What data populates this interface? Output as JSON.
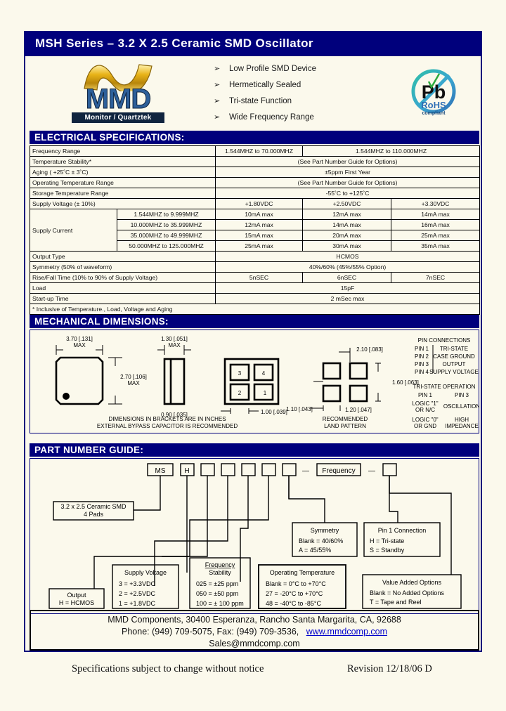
{
  "document": {
    "title": "MSH Series – 3.2 X 2.5 Ceramic SMD Oscillator"
  },
  "features": {
    "bullet_glyph": "➢",
    "items": [
      "Low Profile SMD Device",
      "Hermetically Sealed",
      "Tri-state Function",
      "Wide Frequency Range"
    ]
  },
  "logo": {
    "name": "MMD",
    "tagline": "Monitor / Quartztek"
  },
  "rohs": {
    "symbol": "Pb",
    "line1": "RoHS",
    "line2": "compliant"
  },
  "electrical": {
    "heading": "ELECTRICAL SPECIFICATIONS:",
    "rows": [
      {
        "label": "Frequency Range",
        "cells": [
          "1.544MHZ to 70.000MHZ",
          "1.544MHZ to 110.000MHZ"
        ],
        "spans": [
          1,
          2
        ]
      },
      {
        "label": "Temperature Stability*",
        "cells": [
          "(See Part Number Guide for Options)"
        ],
        "spans": [
          3
        ]
      },
      {
        "label": "Aging ( +25˚C ± 3˚C)",
        "cells": [
          "±5ppm First Year"
        ],
        "spans": [
          3
        ]
      },
      {
        "label": "Operating Temperature Range",
        "cells": [
          "(See Part Number Guide for Options)"
        ],
        "spans": [
          3
        ]
      },
      {
        "label": "Storage Temperature Range",
        "cells": [
          "-55˚C to +125˚C"
        ],
        "spans": [
          3
        ]
      },
      {
        "label": "Supply Voltage (± 10%)",
        "cells": [
          "+1.80VDC",
          "+2.50VDC",
          "+3.30VDC"
        ],
        "spans": [
          1,
          1,
          1
        ]
      }
    ],
    "supply_current": {
      "label": "Supply Current",
      "ranges": [
        "1.544MHZ to 9.999MHZ",
        "10.000MHZ to 35.999MHZ",
        "35.000MHZ to 49.999MHZ",
        "50.000MHZ to 125.000MHZ"
      ],
      "values": [
        [
          "10mA max",
          "12mA max",
          "14mA max"
        ],
        [
          "12mA max",
          "14mA max",
          "16mA max"
        ],
        [
          "15mA max",
          "20mA max",
          "25mA max"
        ],
        [
          "25mA max",
          "30mA max",
          "35mA max"
        ]
      ]
    },
    "rows_tail": [
      {
        "label": "Output Type",
        "cells": [
          "HCMOS"
        ],
        "spans": [
          3
        ]
      },
      {
        "label": "Symmetry (50% of waveform)",
        "cells": [
          "40%/60% (45%/55% Option)"
        ],
        "spans": [
          3
        ]
      },
      {
        "label": "Rise/Fall Time (10% to 90% of Supply Voltage)",
        "cells": [
          "5nSEC",
          "6nSEC",
          "7nSEC"
        ],
        "spans": [
          1,
          1,
          1
        ]
      },
      {
        "label": "Load",
        "cells": [
          "15pF"
        ],
        "spans": [
          3
        ]
      },
      {
        "label": "Start-up Time",
        "cells": [
          "2 mSec max"
        ],
        "spans": [
          3
        ]
      }
    ],
    "footnote": "*  Inclusive of Temperature., Load, Voltage and Aging"
  },
  "mechanical": {
    "heading": "MECHANICAL DIMENSIONS:",
    "dim_width": "3.70 [.131]",
    "dim_width_note": "MAX",
    "dim_height": "2.70 [.106]",
    "dim_height_note": "MAX",
    "dim_thickness": "1.30 [.051]",
    "dim_thickness_note": "MAX",
    "dim_pad_a": "0.90 [.035]",
    "dim_pad_b": "1.00 [.039]",
    "dim_land_a": "2.10 [.083]",
    "dim_land_b": "1.60 [.063]",
    "dim_land_c": "1.10 [.043]",
    "dim_land_d": "1.20 [.047]",
    "pad_numbers": [
      "3",
      "4",
      "2",
      "1"
    ],
    "note1": "DIMENSIONS IN BRACKETS ARE IN INCHES",
    "note2": "EXTERNAL BYPASS CAPACITOR IS RECOMMENDED",
    "land_caption1": "RECOMMENDED",
    "land_caption2": "LAND PATTERN",
    "pin_connections": {
      "title": "PIN CONNECTIONS",
      "rows": [
        {
          "pin": "PIN 1",
          "fn": "TRI-STATE"
        },
        {
          "pin": "PIN 2",
          "fn": "CASE GROUND"
        },
        {
          "pin": "PIN 3",
          "fn": "OUTPUT"
        },
        {
          "pin": "PIN 4",
          "fn": "SUPPLY VOLTAGE"
        }
      ]
    },
    "tri_state": {
      "title": "TRI-STATE OPERATION",
      "col1": "PIN 1",
      "col2": "PIN 3",
      "rows": [
        {
          "a1": "LOGIC \"1\"",
          "a2": "OR N/C",
          "b": "OSCILLATION"
        },
        {
          "a1": "LOGIC \"0\"",
          "a2": "OR GND",
          "b1": "HIGH",
          "b2": "IMPEDANCE"
        }
      ]
    }
  },
  "part_number_guide": {
    "heading": "PART NUMBER GUIDE:",
    "boxes": [
      "MS",
      "H",
      "",
      "",
      "",
      "",
      "",
      "—",
      "Frequency",
      "—",
      ""
    ],
    "callouts": {
      "package": {
        "line1": "3.2 x 2.5 Ceramic SMD",
        "line2": "4 Pads"
      },
      "output": {
        "title": "Output",
        "lines": [
          "H = HCMOS"
        ]
      },
      "supply_voltage": {
        "title": "Supply Voltage",
        "lines": [
          "3 = +3.3VDC",
          "2 = +2.5VDC",
          "1 = +1.8VDC"
        ]
      },
      "frequency_stability": {
        "title1": "Frequency",
        "title2": "Stability",
        "lines": [
          "025 = ±25 ppm",
          "050 = ±50 ppm",
          "100 = ± 100 ppm"
        ]
      },
      "operating_temperature": {
        "title": "Operating Temperature",
        "lines": [
          "Blank = 0°C to +70°C",
          "27 = -20°C to +70°C",
          "48 = -40°C to -85°C"
        ]
      },
      "symmetry": {
        "title": "Symmetry",
        "lines": [
          "Blank = 40/60%",
          "A = 45/55%"
        ]
      },
      "pin1_connection": {
        "title": "Pin 1 Connection",
        "lines": [
          "H = Tri-state",
          "S = Standby"
        ]
      },
      "value_added": {
        "title": "Value Added Options",
        "lines": [
          "Blank = No Added Options",
          "T = Tape and Reel"
        ]
      }
    }
  },
  "footer": {
    "line1": "MMD Components, 30400 Esperanza, Rancho Santa Margarita, CA, 92688",
    "line2a": "Phone: (949) 709-5075, Fax: (949) 709-3536,",
    "line2_link": "www.mmdcomp.com",
    "line3": "Sales@mmdcomp.com"
  },
  "bottom": {
    "disclaimer": "Specifications subject to change without notice",
    "revision": "Revision 12/18/06 D"
  },
  "colors": {
    "header_blue": "#00007c",
    "page_bg": "#fbf9ec",
    "link": "#0000cc",
    "logo_blue": "#2d5f9a",
    "logo_gold": "#e8b317"
  }
}
